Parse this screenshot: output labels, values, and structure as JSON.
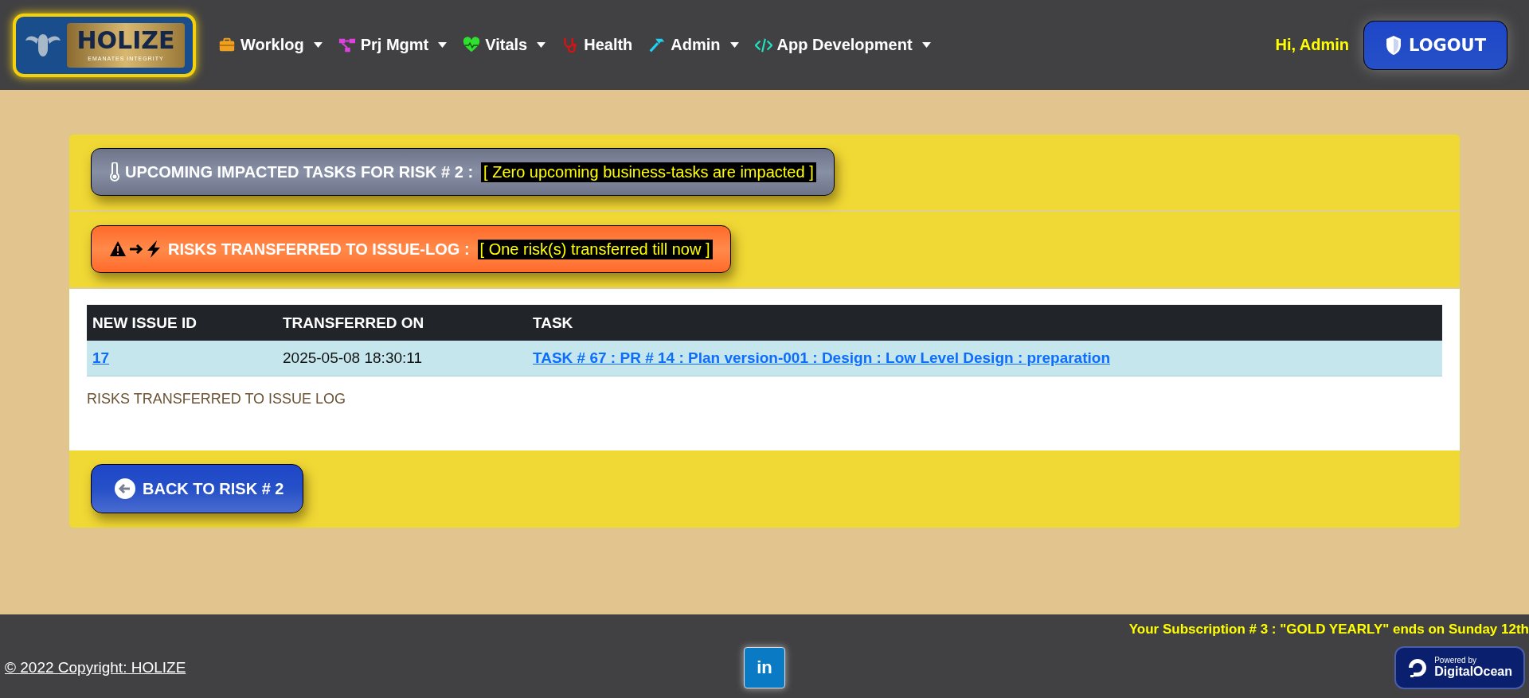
{
  "navbar": {
    "logo": {
      "title": "HOLIZE",
      "tagline": "EMANATES INTEGRITY"
    },
    "menu": [
      {
        "label": "Worklog",
        "dropdown": true
      },
      {
        "label": "Prj Mgmt",
        "dropdown": true
      },
      {
        "label": "Vitals",
        "dropdown": true
      },
      {
        "label": "Health",
        "dropdown": false
      },
      {
        "label": "Admin",
        "dropdown": true
      },
      {
        "label": "App Development",
        "dropdown": true
      }
    ],
    "greeting": "Hi, Admin",
    "logout": "LOGOUT"
  },
  "sections": [
    {
      "kind": "impact",
      "title": "UPCOMING IMPACTED TASKS FOR RISK # 2 :",
      "note": "[ Zero upcoming business-tasks are impacted ]"
    },
    {
      "kind": "transfer",
      "title": "RISKS TRANSFERRED TO ISSUE-LOG :",
      "note": "[ One risk(s) transferred till now ]"
    }
  ],
  "table": {
    "columns": [
      "NEW ISSUE ID",
      "TRANSFERRED ON",
      "TASK"
    ],
    "rows": [
      {
        "issue_id": "17",
        "transferred_on": "2025-05-08 18:30:11",
        "task": "TASK # 67 : PR # 14 : Plan version-001 : Design : Low Level Design : preparation"
      }
    ],
    "caption": "RISKS TRANSFERRED TO ISSUE LOG"
  },
  "back_button": "BACK TO RISK # 2",
  "footer": {
    "subscription": "Your Subscription # 3 : \"GOLD YEARLY\" ends on Sunday 12th",
    "copyright": "© 2022 Copyright: HOLIZE",
    "linkedin": "in",
    "badge": {
      "line1": "Powered by",
      "line2": "DigitalOcean"
    }
  }
}
